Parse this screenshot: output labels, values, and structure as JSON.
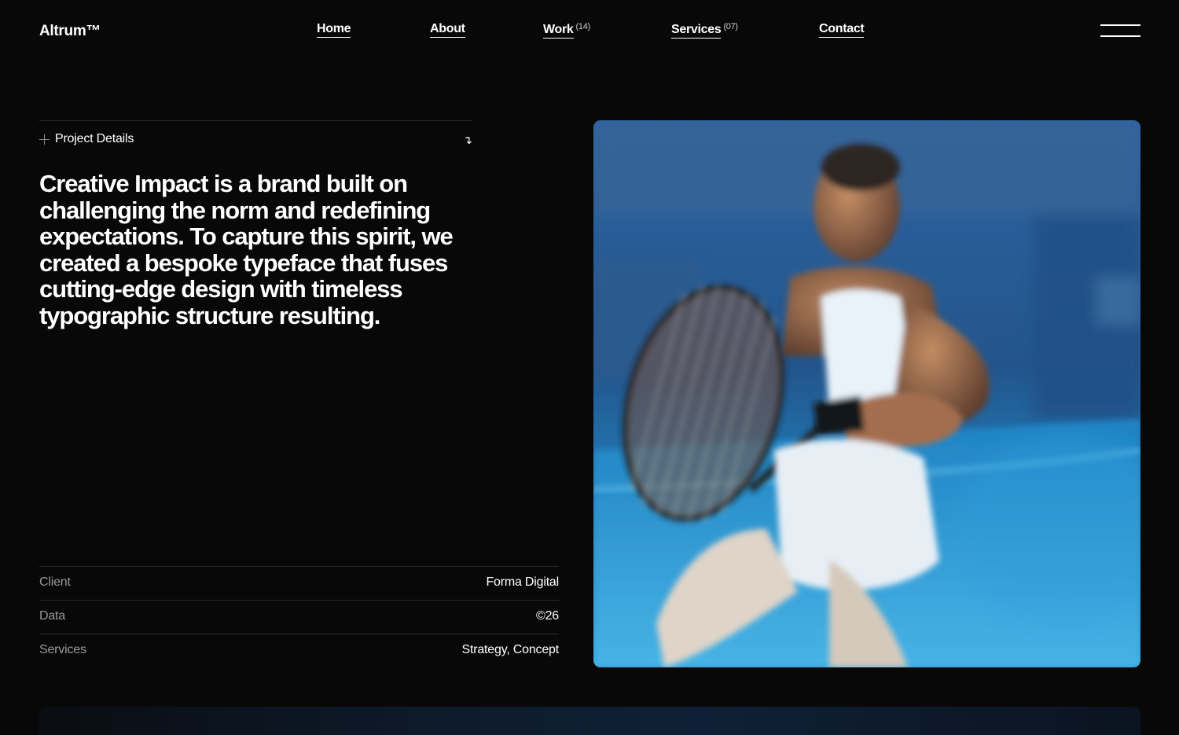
{
  "header": {
    "brand": "Altrum™",
    "nav": [
      {
        "label": "Home",
        "count": ""
      },
      {
        "label": "About",
        "count": ""
      },
      {
        "label": "Work",
        "count": "(14)"
      },
      {
        "label": "Services",
        "count": "(07)"
      },
      {
        "label": "Contact",
        "count": ""
      }
    ],
    "menu_icon": "hamburger-menu-icon"
  },
  "project": {
    "details_label": "Project Details",
    "expand_icon": "plus-icon",
    "arrow_icon": "arrow-down-right-icon",
    "description": "Creative Impact is a brand built on challenging the norm and redefining expectations. To capture this spirit, we created a bespoke typeface that fuses cutting-edge design with timeless typographic structure resulting.",
    "meta": [
      {
        "key": "Client",
        "value": "Forma Digital"
      },
      {
        "key": "Data",
        "value": "©26"
      },
      {
        "key": "Services",
        "value": "Strategy, Concept"
      }
    ]
  },
  "hero": {
    "subject": "tennis-player-photo"
  },
  "colors": {
    "background": "#080808",
    "text": "#ffffff",
    "muted": "#9a9a9a",
    "divider": "#2a2a2a",
    "court_blue": "#1f8fd0"
  }
}
